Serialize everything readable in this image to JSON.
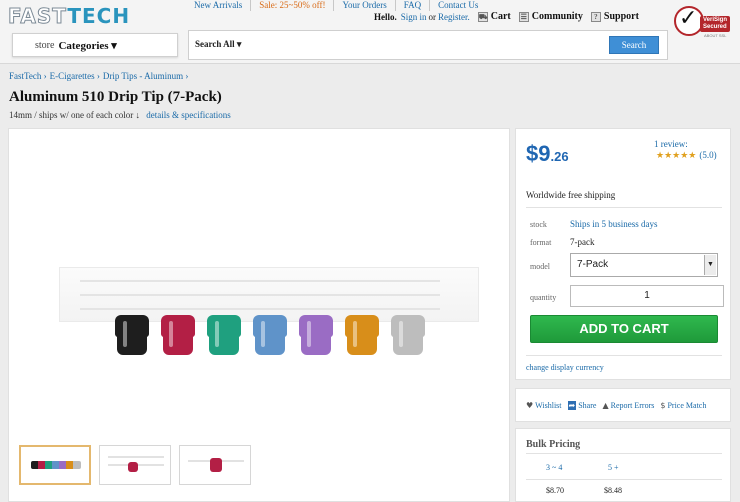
{
  "header": {
    "logo_part1": "FAST",
    "logo_part2": "TECH",
    "nav": [
      "New Arrivals",
      "Sale: 25~50% off!",
      "Your Orders",
      "FAQ",
      "Contact Us"
    ],
    "hello": "Hello.",
    "sign_in": "Sign in",
    "or": "or",
    "register": "Register.",
    "cart": "Cart",
    "community": "Community",
    "support": "Support",
    "verisign": "VeriSign Secured",
    "verisign_sub": "ABOUT SSL",
    "store_label": "store",
    "categories_label": "Categories ▾",
    "search_scope": "Search All ▾",
    "search_value": "",
    "search_button": "Search"
  },
  "breadcrumb": [
    "FastTech ›",
    "E-Cigarettes ›",
    "Drip Tips - Aluminum ›"
  ],
  "product": {
    "title": "Aluminum 510 Drip Tip (7-Pack)",
    "subtitle": "14mm / ships w/ one of each color ↓",
    "details_link": "details & specifications",
    "tip_colors": [
      "#1e1e1e",
      "#b31f45",
      "#1fa07f",
      "#5f93c9",
      "#9a6cc4",
      "#d88e1a",
      "#bdbdbd"
    ]
  },
  "buy": {
    "price_whole": "$9",
    "price_cents": ".26",
    "review_link": "1 review:",
    "stars": "★★★★★",
    "rating": "(5.0)",
    "shipping": "Worldwide free shipping",
    "stock_label": "stock",
    "stock_value": "Ships in 5 business days",
    "format_label": "format",
    "format_value": "7-pack",
    "model_label": "model",
    "model_value": "7-Pack",
    "quantity_label": "quantity",
    "quantity_value": "1",
    "add_to_cart": "ADD TO CART",
    "currency_link": "change display currency"
  },
  "actions": {
    "wishlist": "Wishlist",
    "share": "Share",
    "report": "Report Errors",
    "price_match": "Price Match"
  },
  "bulk": {
    "title": "Bulk Pricing",
    "tiers": [
      "3 ~ 4",
      "5 +"
    ],
    "prices": [
      "$8.70",
      "$8.48"
    ]
  }
}
